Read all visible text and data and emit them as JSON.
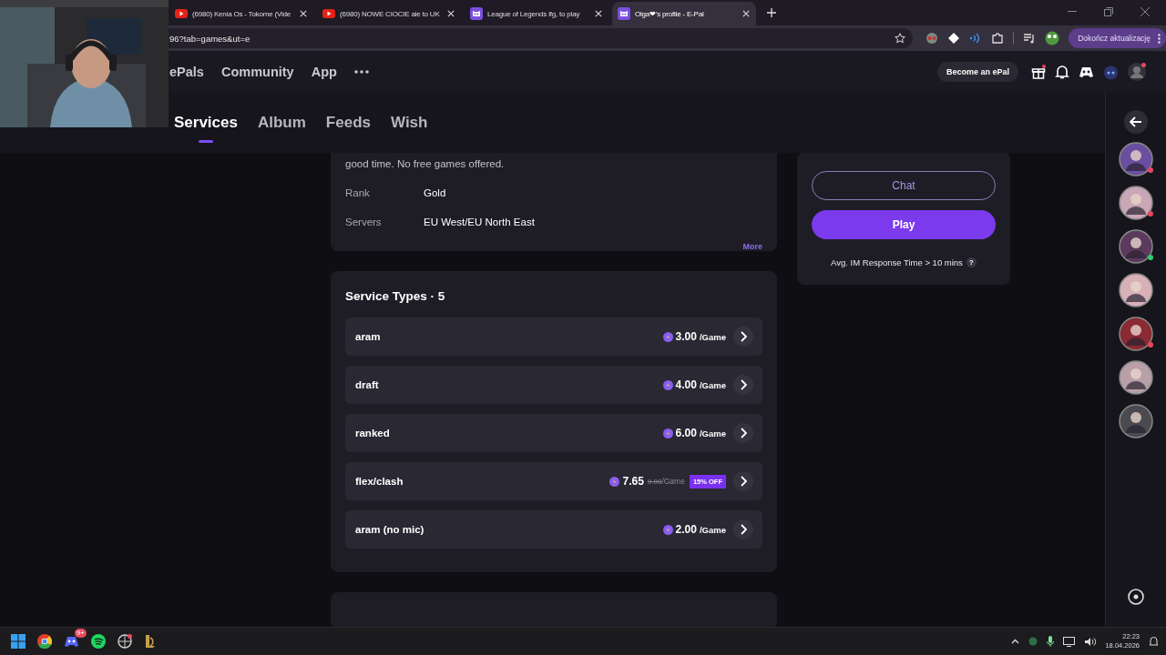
{
  "browser": {
    "tabs": [
      {
        "title": "(6980) Kenia Os - Tokome (Vide",
        "kind": "video",
        "selected": false
      },
      {
        "title": "(6980) NOWE CIOCIE ale to UK",
        "kind": "video",
        "selected": false
      },
      {
        "title": "League of Legends lfg, to play",
        "kind": "cat",
        "selected": false
      },
      {
        "title": "Olga❤'s profile - E-Pal",
        "kind": "cat",
        "selected": true
      }
    ],
    "address": "96?tab=games&ut=e",
    "update_button": "Dokończ aktualizację"
  },
  "site_nav": {
    "items": [
      "ePals",
      "Community",
      "App"
    ],
    "become_button": "Become an ePal"
  },
  "profile_tabs": [
    {
      "label": "Services",
      "selected": true
    },
    {
      "label": "Album",
      "selected": false
    },
    {
      "label": "Feeds",
      "selected": false
    },
    {
      "label": "Wish",
      "selected": false
    }
  ],
  "details": {
    "description": "good time. No free games offered.",
    "fields": [
      {
        "label": "Rank",
        "value": "Gold"
      },
      {
        "label": "Servers",
        "value": "EU West/EU North East"
      }
    ],
    "more": "More"
  },
  "services": {
    "title": "Service Types · 5",
    "items": [
      {
        "name": "aram",
        "price": "3.00",
        "unit": "/Game"
      },
      {
        "name": "draft",
        "price": "4.00",
        "unit": "/Game"
      },
      {
        "name": "ranked",
        "price": "6.00",
        "unit": "/Game"
      },
      {
        "name": "flex/clash",
        "price": "7.65",
        "original_price": "9.00",
        "unit": "/Game",
        "discount": "15% OFF"
      },
      {
        "name": "aram (no mic)",
        "price": "2.00",
        "unit": "/Game"
      }
    ]
  },
  "actions": {
    "chat": "Chat",
    "play": "Play",
    "response_time": "Avg. IM Response Time > 10 mins",
    "help": "?"
  },
  "taskbar": {
    "apps": [
      {
        "kind": "start"
      },
      {
        "kind": "browser"
      },
      {
        "kind": "chat",
        "badge": "9+"
      },
      {
        "kind": "music"
      },
      {
        "kind": "game"
      },
      {
        "kind": "league"
      }
    ],
    "time": "22:23",
    "date": "18.04.2026"
  }
}
